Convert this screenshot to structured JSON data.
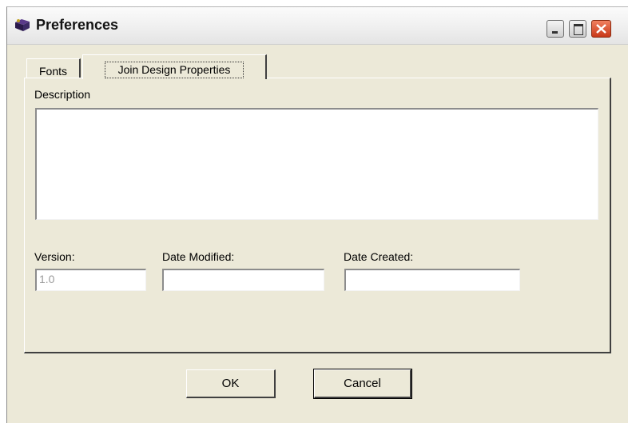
{
  "window": {
    "title": "Preferences",
    "app_icon": "preferences-app-icon",
    "controls": [
      "minimize-icon",
      "maximize-icon",
      "close-icon"
    ]
  },
  "tabs": [
    {
      "label": "Fonts",
      "selected": false
    },
    {
      "label": "Join Design Properties",
      "selected": true
    }
  ],
  "form": {
    "description_label": "Description",
    "description_value": "",
    "version_label": "Version:",
    "version_value": "1.0",
    "date_modified_label": "Date Modified:",
    "date_modified_value": "",
    "date_created_label": "Date Created:",
    "date_created_value": ""
  },
  "buttons": {
    "ok_label": "OK",
    "cancel_label": "Cancel"
  },
  "colors": {
    "dialog_face": "#ece9d8",
    "close_button": "#d84a28",
    "disabled_text": "#9a9a9a"
  }
}
